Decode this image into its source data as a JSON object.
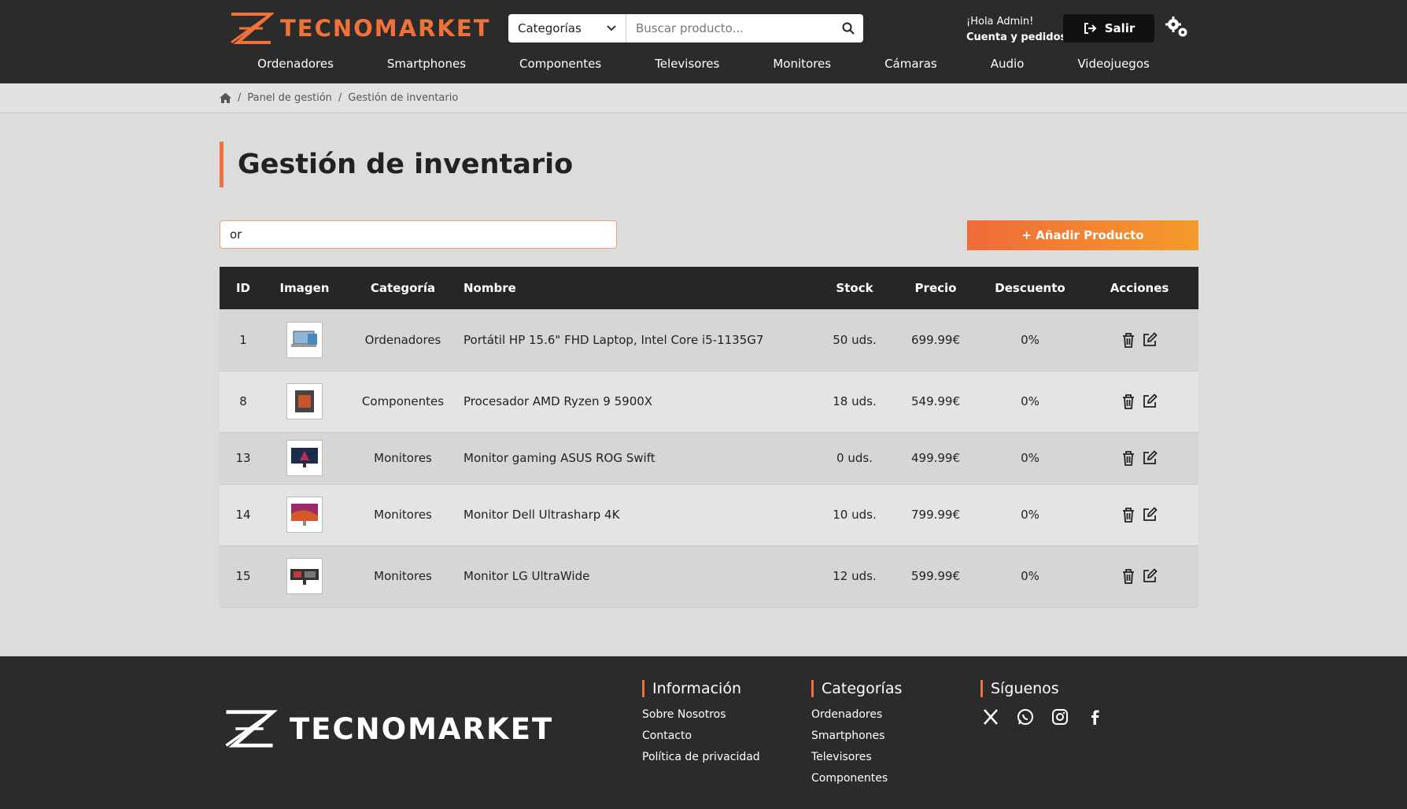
{
  "header": {
    "logo_text": "TECNOMARKET",
    "category_select": "Categorías",
    "search_placeholder": "Buscar producto...",
    "greeting": "¡Hola Admin!",
    "account_link": "Cuenta y pedidos",
    "logout_label": "Salir",
    "accent_color": "#f0713a"
  },
  "nav": [
    "Ordenadores",
    "Smartphones",
    "Componentes",
    "Televisores",
    "Monitores",
    "Cámaras",
    "Audio",
    "Videojuegos"
  ],
  "breadcrumb": {
    "items": [
      "Panel de gestión",
      "Gestión de inventario"
    ]
  },
  "main": {
    "title": "Gestión de inventario",
    "filter_value": "or",
    "add_button": "+ Añadir Producto"
  },
  "table": {
    "columns": [
      "ID",
      "Imagen",
      "Categoría",
      "Nombre",
      "Stock",
      "Precio",
      "Descuento",
      "Acciones"
    ],
    "rows": [
      {
        "id": "1",
        "image": "laptop",
        "category": "Ordenadores",
        "name": "Portátil HP 15.6\" FHD Laptop, Intel Core i5-1135G7",
        "stock": "50 uds.",
        "price": "699.99€",
        "discount": "0%"
      },
      {
        "id": "8",
        "image": "cpu",
        "category": "Componentes",
        "name": "Procesador AMD Ryzen 9 5900X",
        "stock": "18 uds.",
        "price": "549.99€",
        "discount": "0%"
      },
      {
        "id": "13",
        "image": "monitor-rog",
        "category": "Monitores",
        "name": "Monitor gaming ASUS ROG Swift",
        "stock": "0 uds.",
        "price": "499.99€",
        "discount": "0%"
      },
      {
        "id": "14",
        "image": "monitor-dell",
        "category": "Monitores",
        "name": "Monitor Dell Ultrasharp 4K",
        "stock": "10 uds.",
        "price": "799.99€",
        "discount": "0%"
      },
      {
        "id": "15",
        "image": "monitor-lg",
        "category": "Monitores",
        "name": "Monitor LG UltraWide",
        "stock": "12 uds.",
        "price": "599.99€",
        "discount": "0%"
      }
    ]
  },
  "footer": {
    "logo_text": "TECNOMARKET",
    "info_title": "Información",
    "info_links": [
      "Sobre Nosotros",
      "Contacto",
      "Política de privacidad"
    ],
    "cat_title": "Categorías",
    "cat_links": [
      "Ordenadores",
      "Smartphones",
      "Televisores",
      "Componentes"
    ],
    "social_title": "Síguenos",
    "social_icons": [
      "x-icon",
      "whatsapp-icon",
      "instagram-icon",
      "facebook-icon"
    ]
  }
}
